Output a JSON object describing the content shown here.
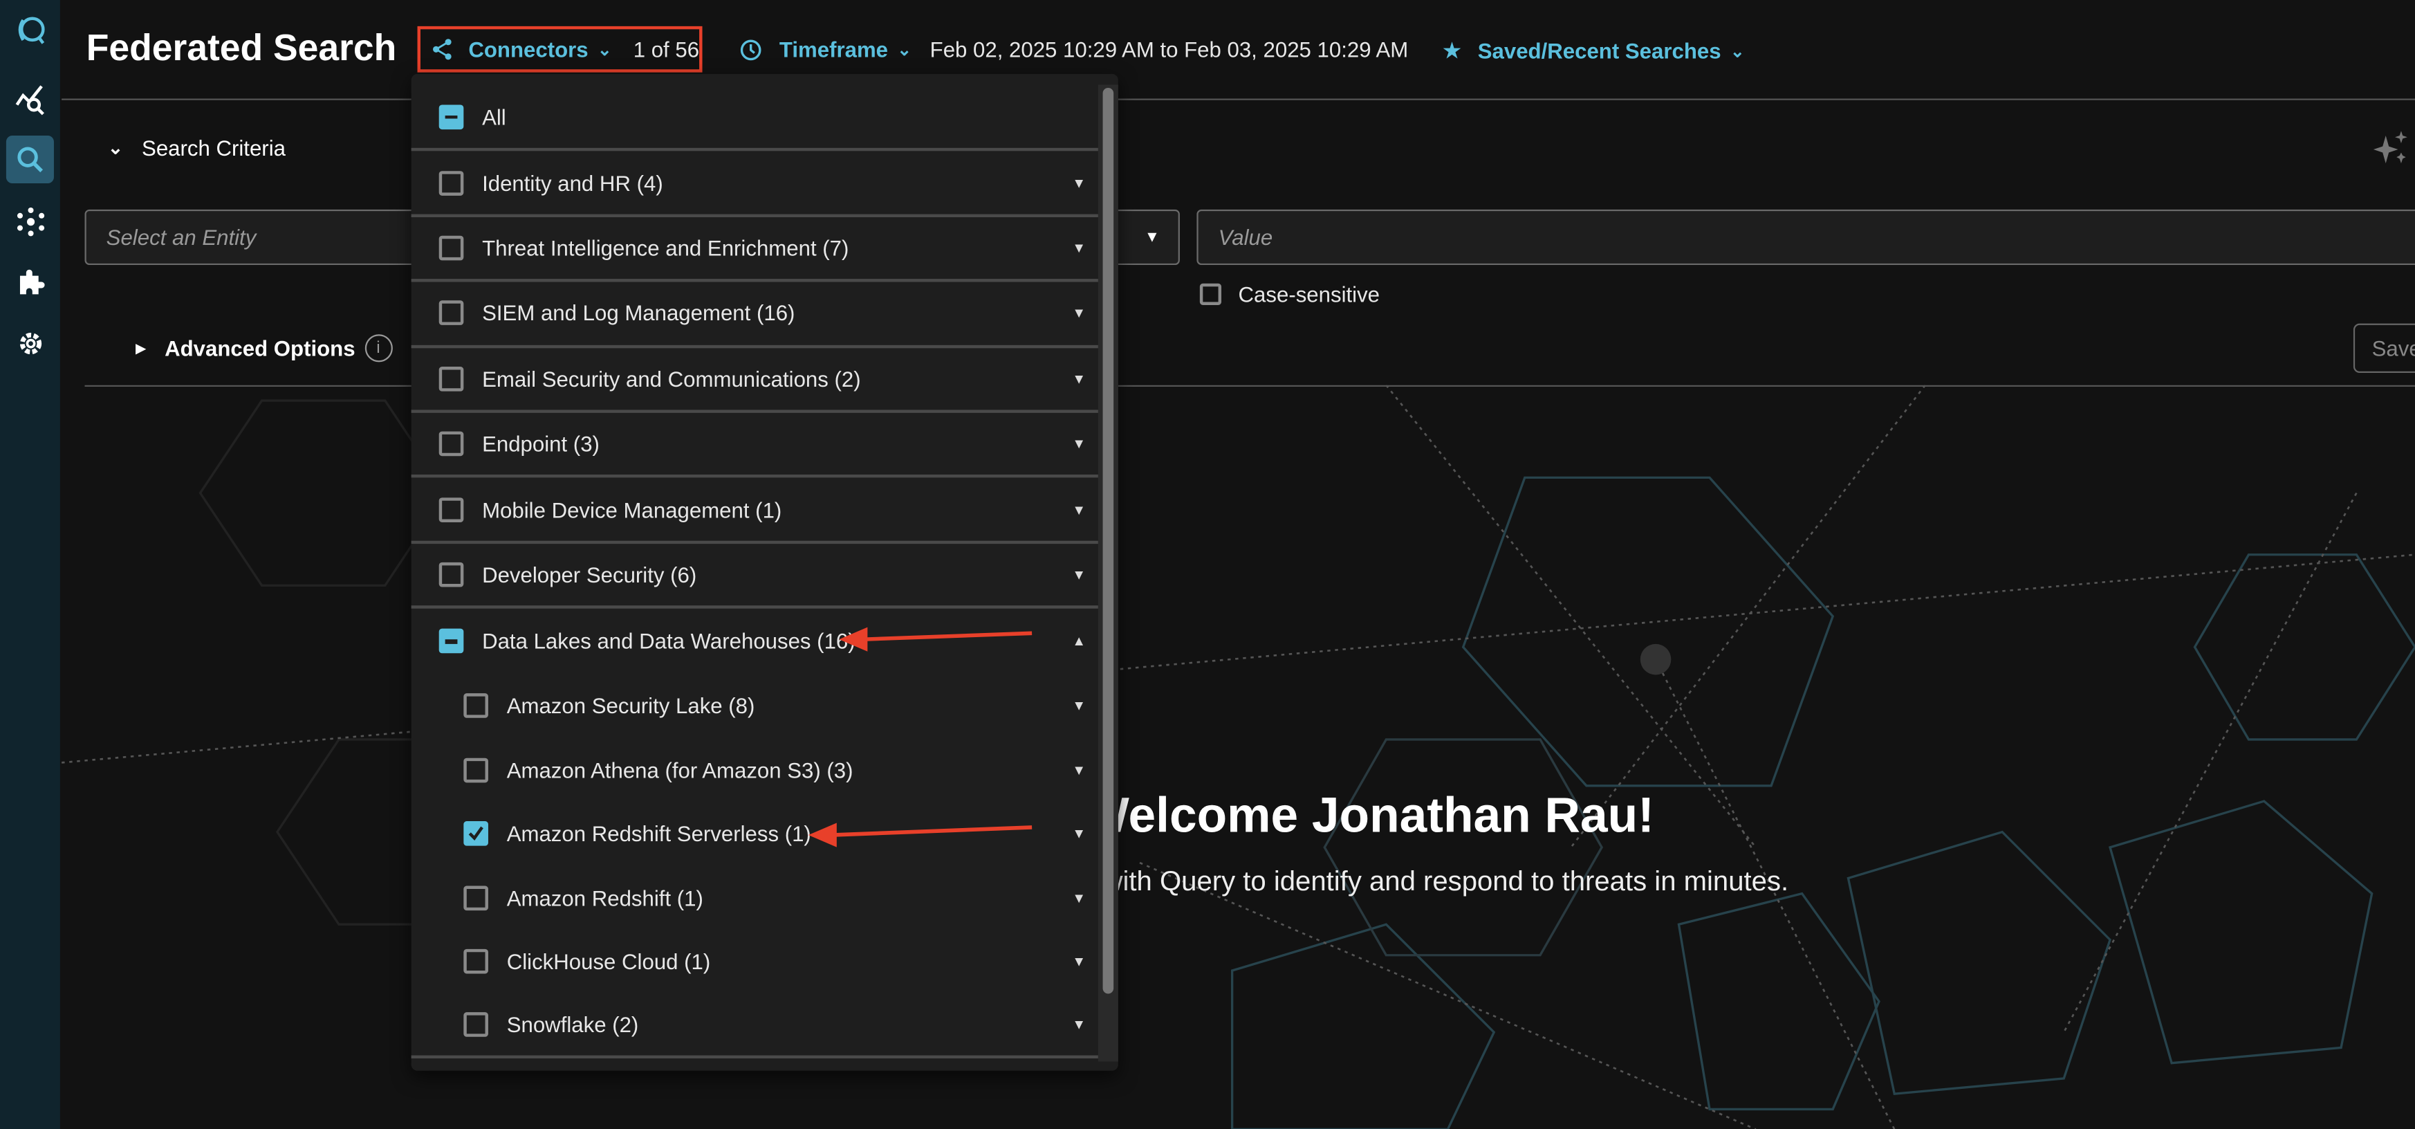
{
  "colors": {
    "accent": "#5bc0de",
    "annotation": "#e8402a",
    "background": "#121212",
    "sidebar": "#10242d",
    "panel": "#1e1e1e"
  },
  "sidebar": {
    "items": [
      {
        "name": "query-logo-icon",
        "active": false
      },
      {
        "name": "analytics-search-icon",
        "active": false
      },
      {
        "name": "search-icon",
        "active": true
      },
      {
        "name": "network-icon",
        "active": false
      },
      {
        "name": "puzzle-icon",
        "active": false
      },
      {
        "name": "gear-icon",
        "active": false
      }
    ]
  },
  "header": {
    "title": "Federated Search",
    "connectors": {
      "label": "Connectors",
      "count": "1 of 56",
      "icon": "share-nodes-icon"
    },
    "timeframe": {
      "label": "Timeframe",
      "range": "Feb 02, 2025 10:29 AM to Feb 03, 2025 10:29 AM",
      "icon": "clock-icon"
    },
    "saved": {
      "label": "Saved/Recent Searches",
      "icon": "star-icon"
    }
  },
  "criteria": {
    "title": "Search Criteria",
    "entity_placeholder": "Select an Entity",
    "value_placeholder": "Value",
    "case_sensitive": "Case-sensitive",
    "advanced": "Advanced Options",
    "save": "Save"
  },
  "welcome": {
    "title": "Welcome Jonathan Rau!",
    "subtitle": "with Query to identify and respond to threats in minutes."
  },
  "dropdown": {
    "items": [
      {
        "label": "All",
        "state": "partial",
        "level": 0,
        "caret": ""
      },
      {
        "label": "Identity and HR (4)",
        "state": "off",
        "level": 0,
        "caret": "down"
      },
      {
        "label": "Threat Intelligence and Enrichment (7)",
        "state": "off",
        "level": 0,
        "caret": "down"
      },
      {
        "label": "SIEM and Log Management (16)",
        "state": "off",
        "level": 0,
        "caret": "down"
      },
      {
        "label": "Email Security and Communications (2)",
        "state": "off",
        "level": 0,
        "caret": "down"
      },
      {
        "label": "Endpoint (3)",
        "state": "off",
        "level": 0,
        "caret": "down"
      },
      {
        "label": "Mobile Device Management (1)",
        "state": "off",
        "level": 0,
        "caret": "down"
      },
      {
        "label": "Developer Security (6)",
        "state": "off",
        "level": 0,
        "caret": "down"
      },
      {
        "label": "Data Lakes and Data Warehouses (16)",
        "state": "partial",
        "level": 0,
        "caret": "up"
      },
      {
        "label": "Amazon Security Lake (8)",
        "state": "off",
        "level": 1,
        "caret": "down"
      },
      {
        "label": "Amazon Athena (for Amazon S3) (3)",
        "state": "off",
        "level": 1,
        "caret": "down"
      },
      {
        "label": "Amazon Redshift Serverless (1)",
        "state": "on",
        "level": 1,
        "caret": "down"
      },
      {
        "label": "Amazon Redshift (1)",
        "state": "off",
        "level": 1,
        "caret": "down"
      },
      {
        "label": "ClickHouse Cloud (1)",
        "state": "off",
        "level": 1,
        "caret": "down"
      },
      {
        "label": "Snowflake (2)",
        "state": "off",
        "level": 1,
        "caret": "down"
      }
    ]
  }
}
